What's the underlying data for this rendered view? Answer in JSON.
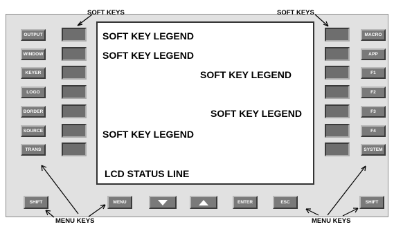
{
  "callouts": {
    "soft_keys_left": "SOFT KEYS",
    "soft_keys_right": "SOFT KEYS",
    "menu_keys_left": "MENU KEYS",
    "menu_keys_right": "MENU KEYS"
  },
  "left_menu_keys": [
    "OUTPUT",
    "WINDOW",
    "KEYER",
    "LOGO",
    "BORDER",
    "SOURCE",
    "TRANS"
  ],
  "right_menu_keys": [
    "MACRO",
    "APP",
    "F1",
    "F2",
    "F3",
    "F4",
    "SYSTEM"
  ],
  "lcd": {
    "legends": [
      "SOFT KEY LEGEND",
      "SOFT KEY LEGEND",
      "SOFT KEY LEGEND",
      "SOFT KEY LEGEND",
      "SOFT KEY LEGEND"
    ],
    "status_line": "LCD STATUS LINE"
  },
  "bottom_keys": {
    "shift_left": "SHIFT",
    "menu": "MENU",
    "down_arrow_icon": "triangle-down",
    "up_arrow_icon": "triangle-up",
    "enter": "ENTER",
    "esc": "ESC",
    "shift_right": "SHIFT"
  },
  "colors": {
    "panel": "#e1e1e1",
    "key_face": "#7a7a7a",
    "soft_key_face": "#6e6e6e",
    "lcd_background": "#ffffff"
  }
}
